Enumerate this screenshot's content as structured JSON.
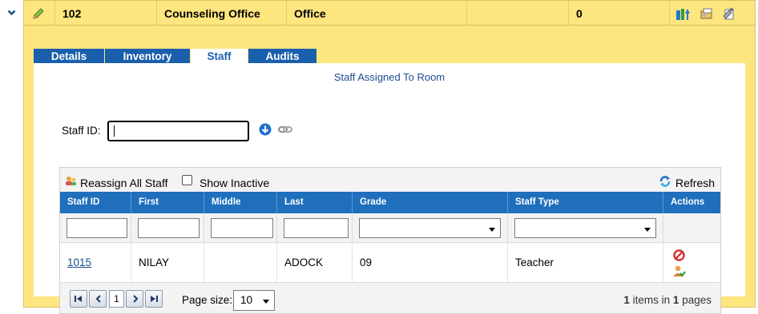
{
  "room": {
    "number": "102",
    "name": "Counseling Office",
    "type": "Office",
    "extra": "",
    "count": "0"
  },
  "tabs": [
    "Details",
    "Inventory",
    "Staff",
    "Audits"
  ],
  "active_tab": "Staff",
  "section_title": "Staff Assigned To Room",
  "staff_id": {
    "label": "Staff ID:",
    "value": ""
  },
  "toolbar": {
    "reassign_label": "Reassign All Staff",
    "show_inactive_label": "Show Inactive",
    "show_inactive_checked": false,
    "refresh_label": "Refresh"
  },
  "columns": [
    "Staff ID",
    "First",
    "Middle",
    "Last",
    "Grade",
    "Staff Type",
    "Actions"
  ],
  "rows": [
    {
      "staff_id": "1015",
      "first": "NILAY",
      "middle": "",
      "last": "ADOCK",
      "grade": "09",
      "staff_type": "Teacher"
    }
  ],
  "pager": {
    "current_page": "1",
    "page_size_label": "Page size:",
    "page_size": "10",
    "items_count": "1",
    "items_text": "items in",
    "pages_count": "1",
    "pages_text": "pages"
  },
  "colors": {
    "band_yellow": "#fde57f",
    "header_blue": "#1f6fbc",
    "tab_blue": "#1a5fac",
    "link_blue": "#1a4f8b"
  }
}
